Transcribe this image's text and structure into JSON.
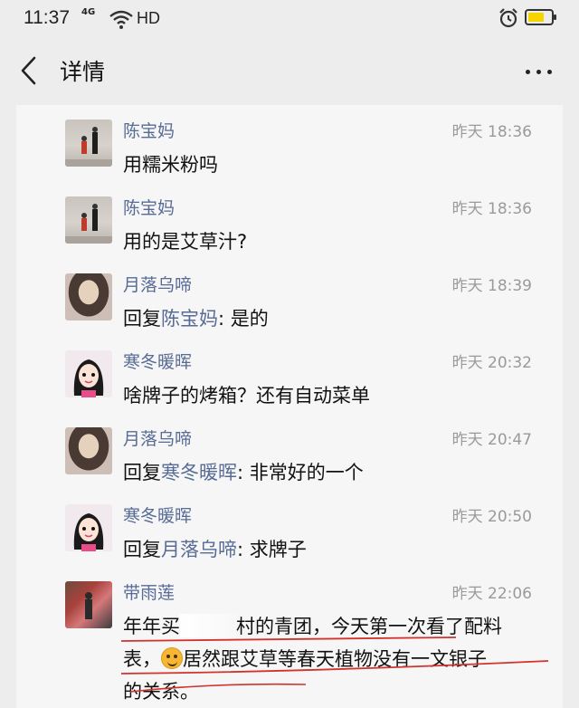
{
  "status_bar": {
    "time": "11:37",
    "network": "4G",
    "network_type": "HD",
    "battery_level": 0.6
  },
  "header": {
    "title": "详情"
  },
  "colors": {
    "link": "#576b95",
    "time": "#9a9a9a",
    "battery": "#f5d400"
  },
  "comments": [
    {
      "author": "陈宝妈",
      "time": "昨天 18:36",
      "text": "用糯米粉吗"
    },
    {
      "author": "陈宝妈",
      "time": "昨天 18:36",
      "text": "用的是艾草汁?"
    },
    {
      "author": "月落乌啼",
      "time": "昨天 18:39",
      "reply_prefix": "回复",
      "reply_to": "陈宝妈",
      "text": ": 是的"
    },
    {
      "author": "寒冬暖晖",
      "time": "昨天 20:32",
      "text": "啥牌子的烤箱？还有自动菜单"
    },
    {
      "author": "月落乌啼",
      "time": "昨天 20:47",
      "reply_prefix": "回复",
      "reply_to": "寒冬暖晖",
      "text": ": 非常好的一个"
    },
    {
      "author": "寒冬暖晖",
      "time": "昨天 20:50",
      "reply_prefix": "回复",
      "reply_to": "月落乌啼",
      "text": ": 求牌子"
    },
    {
      "author": "带雨莲",
      "time": "昨天 22:06",
      "line1_a": "年年买",
      "line1_b": "村的青团，今天第一次看了配料",
      "line2_a": "表，",
      "line2_b": "居然跟艾草等春天植物没有一文银子",
      "line3": "的关系。"
    }
  ]
}
